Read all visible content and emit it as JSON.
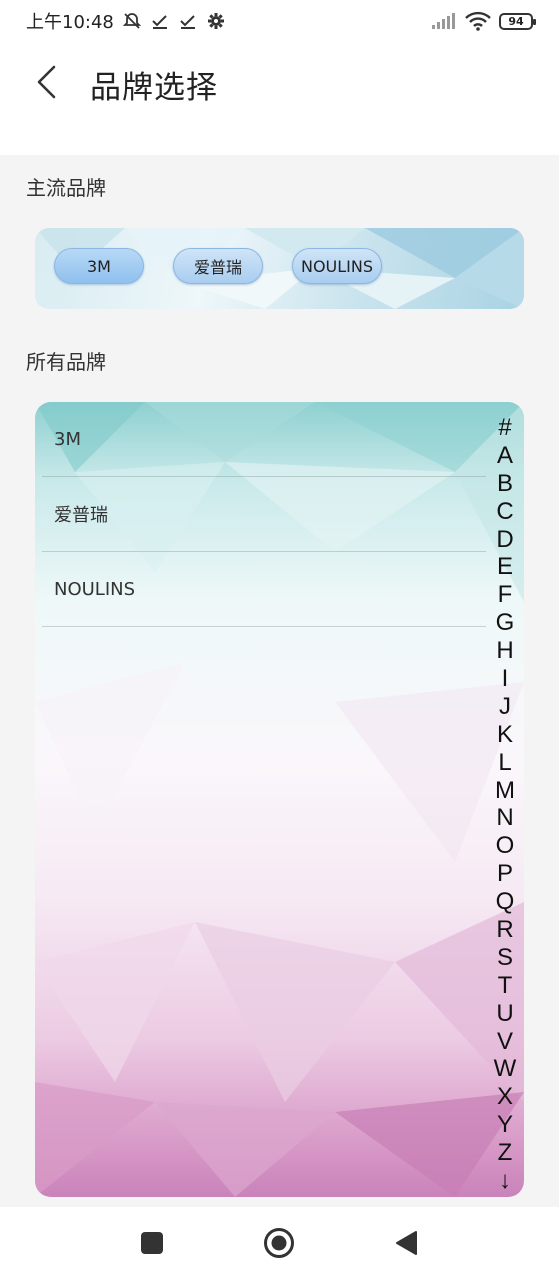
{
  "status_bar": {
    "time": "上午10:48",
    "battery": "94",
    "icons": [
      "alarm-off-icon",
      "check-icon",
      "check-icon",
      "gear-icon",
      "signal-icon",
      "wifi-icon",
      "battery-icon"
    ]
  },
  "header": {
    "title": "品牌选择",
    "back_icon": "chevron-left-icon"
  },
  "mainstream": {
    "title": "主流品牌",
    "brands": [
      {
        "label": "3M"
      },
      {
        "label": "爱普瑞"
      },
      {
        "label": "NOULINS"
      }
    ]
  },
  "all_brands": {
    "title": "所有品牌",
    "items": [
      {
        "label": "3M"
      },
      {
        "label": "爱普瑞"
      },
      {
        "label": "NOULINS"
      }
    ],
    "index": [
      "#",
      "A",
      "B",
      "C",
      "D",
      "E",
      "F",
      "G",
      "H",
      "I",
      "J",
      "K",
      "L",
      "M",
      "N",
      "O",
      "P",
      "Q",
      "R",
      "S",
      "T",
      "U",
      "V",
      "W",
      "X",
      "Y",
      "Z",
      "↓"
    ]
  },
  "nav": {
    "buttons": [
      "square-icon",
      "circle-icon",
      "triangle-back-icon"
    ]
  },
  "colors": {
    "chip_fill": "#a9cdf0",
    "chip_border": "#8bb6e4",
    "card_top": "#8fd0d0",
    "card_bottom": "#c983b9"
  }
}
